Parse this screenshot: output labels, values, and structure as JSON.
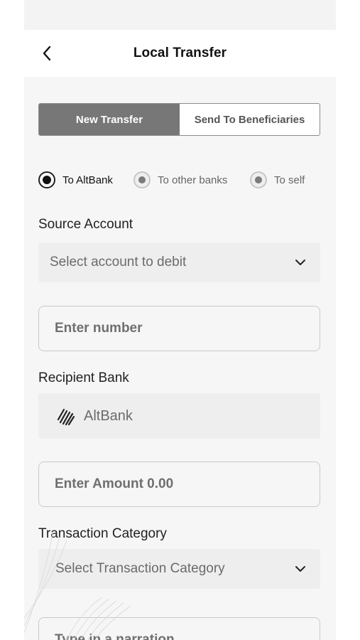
{
  "header": {
    "title": "Local Transfer",
    "back_icon": "chevron-left-icon"
  },
  "tabs": [
    {
      "label": "New Transfer",
      "active": true
    },
    {
      "label": "Send To Beneficiaries",
      "active": false
    }
  ],
  "transfer_type": {
    "options": [
      {
        "label": "To AltBank",
        "selected": true
      },
      {
        "label": "To other banks",
        "selected": false
      },
      {
        "label": "To self",
        "selected": false
      }
    ]
  },
  "source_account": {
    "label": "Source Account",
    "placeholder": "Select account to debit"
  },
  "account_number": {
    "placeholder": "Enter number"
  },
  "recipient_bank": {
    "label": "Recipient Bank",
    "value": "AltBank",
    "logo_icon": "altbank-logo-icon"
  },
  "amount": {
    "placeholder": "Enter Amount 0.00"
  },
  "transaction_category": {
    "label": "Transaction Category",
    "placeholder": "Select Transaction Category"
  },
  "narration": {
    "placeholder": "Type in a narration"
  },
  "colors": {
    "active_tab": "#777777",
    "background": "#f6f6f6",
    "input_fill": "#eeeeee"
  }
}
